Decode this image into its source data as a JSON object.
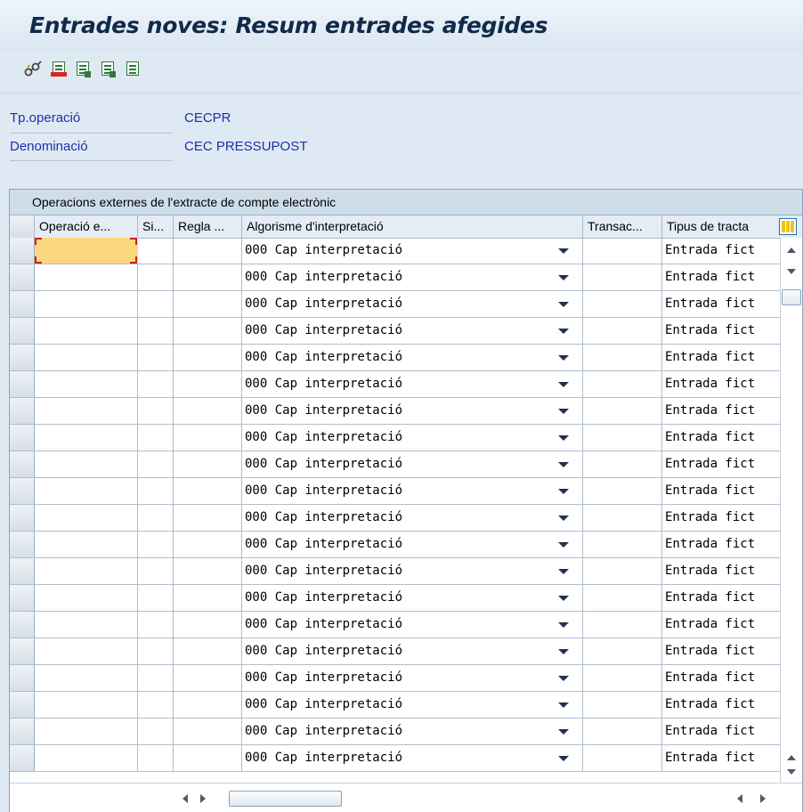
{
  "window": {
    "title": "Entrades noves: Resum entrades afegides"
  },
  "toolbar": {
    "icons": [
      "edit-glasses-icon",
      "delete-row-icon",
      "select-all-icon",
      "select-block-icon",
      "deselect-all-icon"
    ]
  },
  "fields": [
    {
      "label": "Tp.operació",
      "value": "CECPR"
    },
    {
      "label": "Denominació",
      "value": "CEC PRESSUPOST"
    }
  ],
  "table": {
    "caption": "Operacions externes de l'extracte de compte electrònic",
    "columns": [
      "Operació e...",
      "Si...",
      "Regla ...",
      "Algorisme d'interpretació",
      "Transac...",
      "Tipus de tracta"
    ],
    "rows": [
      {
        "op": "",
        "si": "",
        "regla": "",
        "algorisme": "000 Cap interpretació",
        "transac": "",
        "tipus": "Entrada fict"
      },
      {
        "op": "",
        "si": "",
        "regla": "",
        "algorisme": "000 Cap interpretació",
        "transac": "",
        "tipus": "Entrada fict"
      },
      {
        "op": "",
        "si": "",
        "regla": "",
        "algorisme": "000 Cap interpretació",
        "transac": "",
        "tipus": "Entrada fict"
      },
      {
        "op": "",
        "si": "",
        "regla": "",
        "algorisme": "000 Cap interpretació",
        "transac": "",
        "tipus": "Entrada fict"
      },
      {
        "op": "",
        "si": "",
        "regla": "",
        "algorisme": "000 Cap interpretació",
        "transac": "",
        "tipus": "Entrada fict"
      },
      {
        "op": "",
        "si": "",
        "regla": "",
        "algorisme": "000 Cap interpretació",
        "transac": "",
        "tipus": "Entrada fict"
      },
      {
        "op": "",
        "si": "",
        "regla": "",
        "algorisme": "000 Cap interpretació",
        "transac": "",
        "tipus": "Entrada fict"
      },
      {
        "op": "",
        "si": "",
        "regla": "",
        "algorisme": "000 Cap interpretació",
        "transac": "",
        "tipus": "Entrada fict"
      },
      {
        "op": "",
        "si": "",
        "regla": "",
        "algorisme": "000 Cap interpretació",
        "transac": "",
        "tipus": "Entrada fict"
      },
      {
        "op": "",
        "si": "",
        "regla": "",
        "algorisme": "000 Cap interpretació",
        "transac": "",
        "tipus": "Entrada fict"
      },
      {
        "op": "",
        "si": "",
        "regla": "",
        "algorisme": "000 Cap interpretació",
        "transac": "",
        "tipus": "Entrada fict"
      },
      {
        "op": "",
        "si": "",
        "regla": "",
        "algorisme": "000 Cap interpretació",
        "transac": "",
        "tipus": "Entrada fict"
      },
      {
        "op": "",
        "si": "",
        "regla": "",
        "algorisme": "000 Cap interpretació",
        "transac": "",
        "tipus": "Entrada fict"
      },
      {
        "op": "",
        "si": "",
        "regla": "",
        "algorisme": "000 Cap interpretació",
        "transac": "",
        "tipus": "Entrada fict"
      },
      {
        "op": "",
        "si": "",
        "regla": "",
        "algorisme": "000 Cap interpretació",
        "transac": "",
        "tipus": "Entrada fict"
      },
      {
        "op": "",
        "si": "",
        "regla": "",
        "algorisme": "000 Cap interpretació",
        "transac": "",
        "tipus": "Entrada fict"
      },
      {
        "op": "",
        "si": "",
        "regla": "",
        "algorisme": "000 Cap interpretació",
        "transac": "",
        "tipus": "Entrada fict"
      },
      {
        "op": "",
        "si": "",
        "regla": "",
        "algorisme": "000 Cap interpretació",
        "transac": "",
        "tipus": "Entrada fict"
      },
      {
        "op": "",
        "si": "",
        "regla": "",
        "algorisme": "000 Cap interpretació",
        "transac": "",
        "tipus": "Entrada fict"
      },
      {
        "op": "",
        "si": "",
        "regla": "",
        "algorisme": "000 Cap interpretació",
        "transac": "",
        "tipus": "Entrada fict"
      }
    ]
  },
  "colors": {
    "label_blue": "#1e2fa8",
    "focus_cell": "#fcd77d",
    "title": "#102a4a"
  }
}
